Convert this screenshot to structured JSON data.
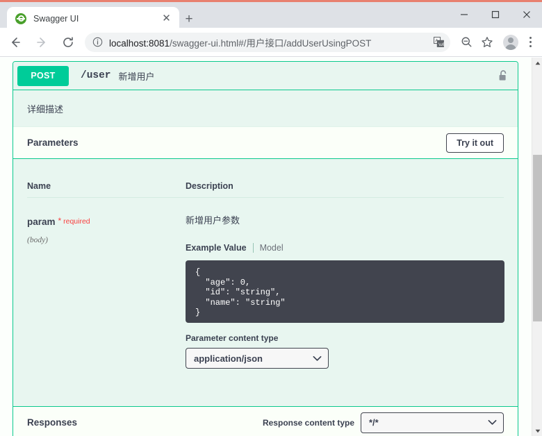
{
  "browser": {
    "tab": {
      "title": "Swagger UI",
      "favicon": "swagger-logo-icon",
      "close_label": "✕"
    },
    "new_tab_label": "+",
    "window_controls": {
      "minimize": "—",
      "maximize": "□",
      "close": "✕"
    },
    "nav": {
      "back": "←",
      "forward": "→",
      "reload": "↻"
    },
    "omnibox": {
      "info_icon": "info-circle-icon",
      "url_host": "localhost:8081",
      "url_path": "/swagger-ui.html#/用户接口/addUserUsingPOST",
      "full_url": "localhost:8081/swagger-ui.html#/用户接口/addUserUsingPOST",
      "translate_icon": "translate-icon"
    },
    "toolbar_icons": [
      "zoom-out-icon",
      "bookmark-star-icon",
      "profile-avatar-icon",
      "chrome-menu-icon"
    ]
  },
  "operation": {
    "method": "POST",
    "path": "/user",
    "summary": "新增用户",
    "lock_icon": "unlocked-padlock-icon",
    "description": "详细描述"
  },
  "parameters": {
    "title": "Parameters",
    "try_it_out_label": "Try it out",
    "columns": {
      "name": "Name",
      "description": "Description"
    },
    "rows": [
      {
        "name": "param",
        "required_star": "*",
        "required_label": "required",
        "type": "(body)",
        "description": "新增用户参数",
        "example_tabs": [
          {
            "label": "Example Value",
            "active": true
          },
          {
            "label": "Model",
            "active": false
          }
        ],
        "example_value": "{\n  \"age\": 0,\n  \"id\": \"string\",\n  \"name\": \"string\"\n}",
        "content_type_label": "Parameter content type",
        "content_type_value": "application/json"
      }
    ]
  },
  "responses": {
    "title": "Responses",
    "content_type_label": "Response content type",
    "content_type_value": "*/*"
  },
  "colors": {
    "post_green": "#00cc99",
    "panel_border": "#0ac98d",
    "panel_bg": "#e8f6f0",
    "section_bg": "#fbfff9",
    "code_bg": "#41444e",
    "required_red": "#f93e3e",
    "text": "#3b4151"
  },
  "scrollbar": {
    "up_arrow": "▲",
    "down_arrow": "▼"
  }
}
